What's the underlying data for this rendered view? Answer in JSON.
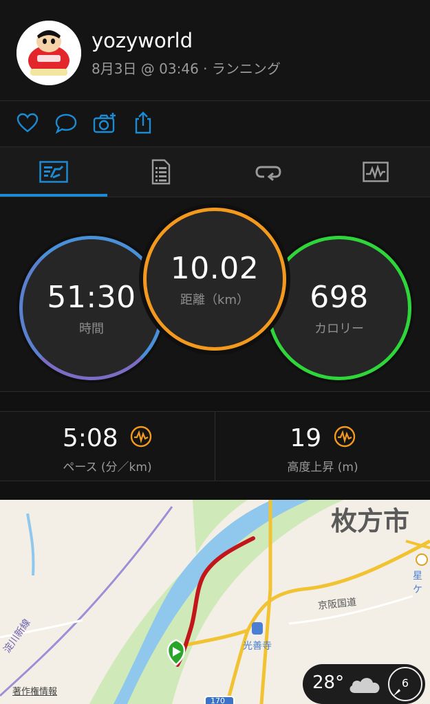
{
  "header": {
    "username": "yozyworld",
    "subline": "8月3日 @ 03:46 · ランニング"
  },
  "actions": {
    "icons": [
      "heart-icon",
      "comment-icon",
      "add-photo-icon",
      "share-icon"
    ]
  },
  "tabs": {
    "icons": [
      "overview-icon",
      "details-icon",
      "laps-icon",
      "charts-icon"
    ],
    "selected_index": 0
  },
  "stats": {
    "time": {
      "value": "51:30",
      "label": "時間"
    },
    "distance": {
      "value": "10.02",
      "label": "距離（km）"
    },
    "calories": {
      "value": "698",
      "label": "カロリー"
    }
  },
  "metrics": {
    "pace": {
      "value": "5:08",
      "label": "ペース (分／km)"
    },
    "elevation": {
      "value": "19",
      "label": "高度上昇 (m)"
    }
  },
  "map": {
    "city_label": "枚方市",
    "road_label": "京阪国道",
    "station_label": "光善寺",
    "poi_partial": "星ケ",
    "route_badge": "170",
    "copyright": "著作権情報",
    "partial_left": "淀川新線"
  },
  "weather": {
    "temperature": "28°",
    "compass_value": "6"
  },
  "colors": {
    "accent_blue": "#1b8bd4",
    "time_ring": "#4a90d9",
    "distance_ring": "#f39a1e",
    "calorie_ring": "#2fd63a",
    "route_red": "#c0161c"
  }
}
